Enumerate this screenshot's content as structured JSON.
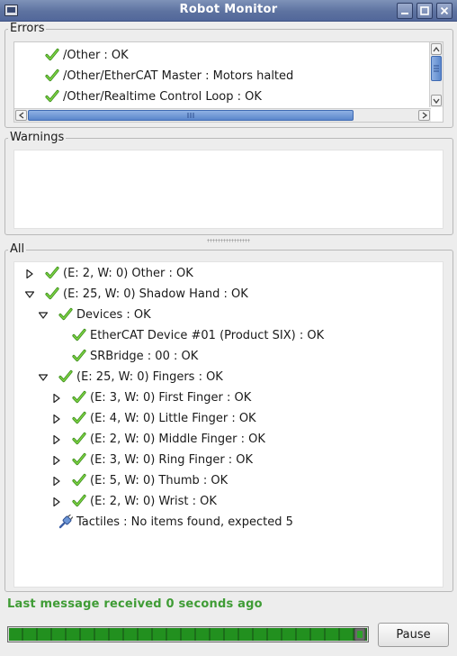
{
  "window": {
    "title": "Robot Monitor",
    "icon": "monitor-icon",
    "buttons": [
      "minimize-icon",
      "maximize-icon",
      "close-icon"
    ]
  },
  "errors": {
    "title": "Errors",
    "items": [
      {
        "label": "/Other : OK",
        "icon": "check-icon"
      },
      {
        "label": "/Other/EtherCAT Master : Motors halted",
        "icon": "check-icon"
      },
      {
        "label": "/Other/Realtime Control Loop : OK",
        "icon": "check-icon"
      }
    ]
  },
  "warnings": {
    "title": "Warnings",
    "items": []
  },
  "all": {
    "title": "All",
    "tree": [
      {
        "label": "(E: 2, W: 0) Other : OK",
        "depth": 0,
        "expander": "collapsed",
        "icon": "check-icon"
      },
      {
        "label": "(E: 25, W: 0) Shadow Hand : OK",
        "depth": 0,
        "expander": "expanded",
        "icon": "check-icon"
      },
      {
        "label": "Devices : OK",
        "depth": 1,
        "expander": "expanded",
        "icon": "check-icon"
      },
      {
        "label": "EtherCAT Device #01 (Product SIX) : OK",
        "depth": 2,
        "expander": "none",
        "icon": "check-icon"
      },
      {
        "label": "SRBridge : 00 : OK",
        "depth": 2,
        "expander": "none",
        "icon": "check-icon"
      },
      {
        "label": "(E: 25, W: 0) Fingers : OK",
        "depth": 1,
        "expander": "expanded",
        "icon": "check-icon"
      },
      {
        "label": "(E: 3, W: 0) First Finger : OK",
        "depth": 2,
        "expander": "collapsed",
        "icon": "check-icon"
      },
      {
        "label": "(E: 4, W: 0) Little Finger : OK",
        "depth": 2,
        "expander": "collapsed",
        "icon": "check-icon"
      },
      {
        "label": "(E: 2, W: 0) Middle Finger : OK",
        "depth": 2,
        "expander": "collapsed",
        "icon": "check-icon"
      },
      {
        "label": "(E: 3, W: 0) Ring Finger : OK",
        "depth": 2,
        "expander": "collapsed",
        "icon": "check-icon"
      },
      {
        "label": "(E: 5, W: 0) Thumb : OK",
        "depth": 2,
        "expander": "collapsed",
        "icon": "check-icon"
      },
      {
        "label": "(E: 2, W: 0) Wrist : OK",
        "depth": 2,
        "expander": "collapsed",
        "icon": "check-icon"
      },
      {
        "label": "Tactiles : No items found, expected 5",
        "depth": 1,
        "expander": "none",
        "icon": "plug-icon"
      }
    ]
  },
  "status": {
    "message": "Last message received 0 seconds ago",
    "color": "#3f9c35",
    "progress_fraction": 1.0
  },
  "controls": {
    "pause_label": "Pause"
  },
  "colors": {
    "titlebar": "#5d72a0",
    "check": "#5cb82a",
    "progress": "#22901f"
  }
}
